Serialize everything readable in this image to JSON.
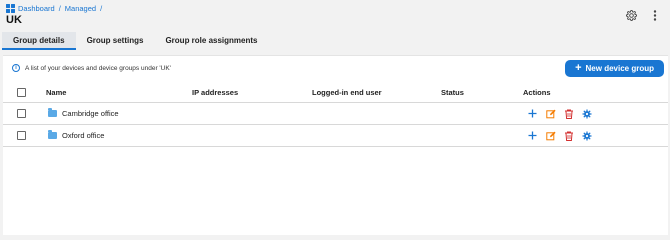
{
  "breadcrumb": {
    "items": [
      "Dashboard",
      "Managed"
    ],
    "separator": "/"
  },
  "page": {
    "title": "UK"
  },
  "tabs": [
    {
      "label": "Group details",
      "active": true
    },
    {
      "label": "Group settings",
      "active": false
    },
    {
      "label": "Group role assignments",
      "active": false
    }
  ],
  "info": {
    "text": "A list of your devices and device groups under 'UK'"
  },
  "toolbar": {
    "new_group_label": "New device group"
  },
  "table": {
    "headers": {
      "name": "Name",
      "ip": "IP addresses",
      "user": "Logged-in end user",
      "status": "Status",
      "actions": "Actions"
    },
    "rows": [
      {
        "name": "Cambridge office",
        "ip": "",
        "user": "",
        "status": ""
      },
      {
        "name": "Oxford office",
        "ip": "",
        "user": "",
        "status": ""
      }
    ]
  },
  "colors": {
    "accent": "#1976d2",
    "folder": "#5aa9e6",
    "add": "#1976d2",
    "edit": "#f57c00",
    "delete": "#d32f2f",
    "settings": "#1976d2"
  },
  "icons": [
    "dashboard-icon",
    "settings-gear-icon",
    "more-vertical-icon",
    "info-icon",
    "plus-icon",
    "folder-icon",
    "edit-icon",
    "delete-icon",
    "cog-icon"
  ]
}
